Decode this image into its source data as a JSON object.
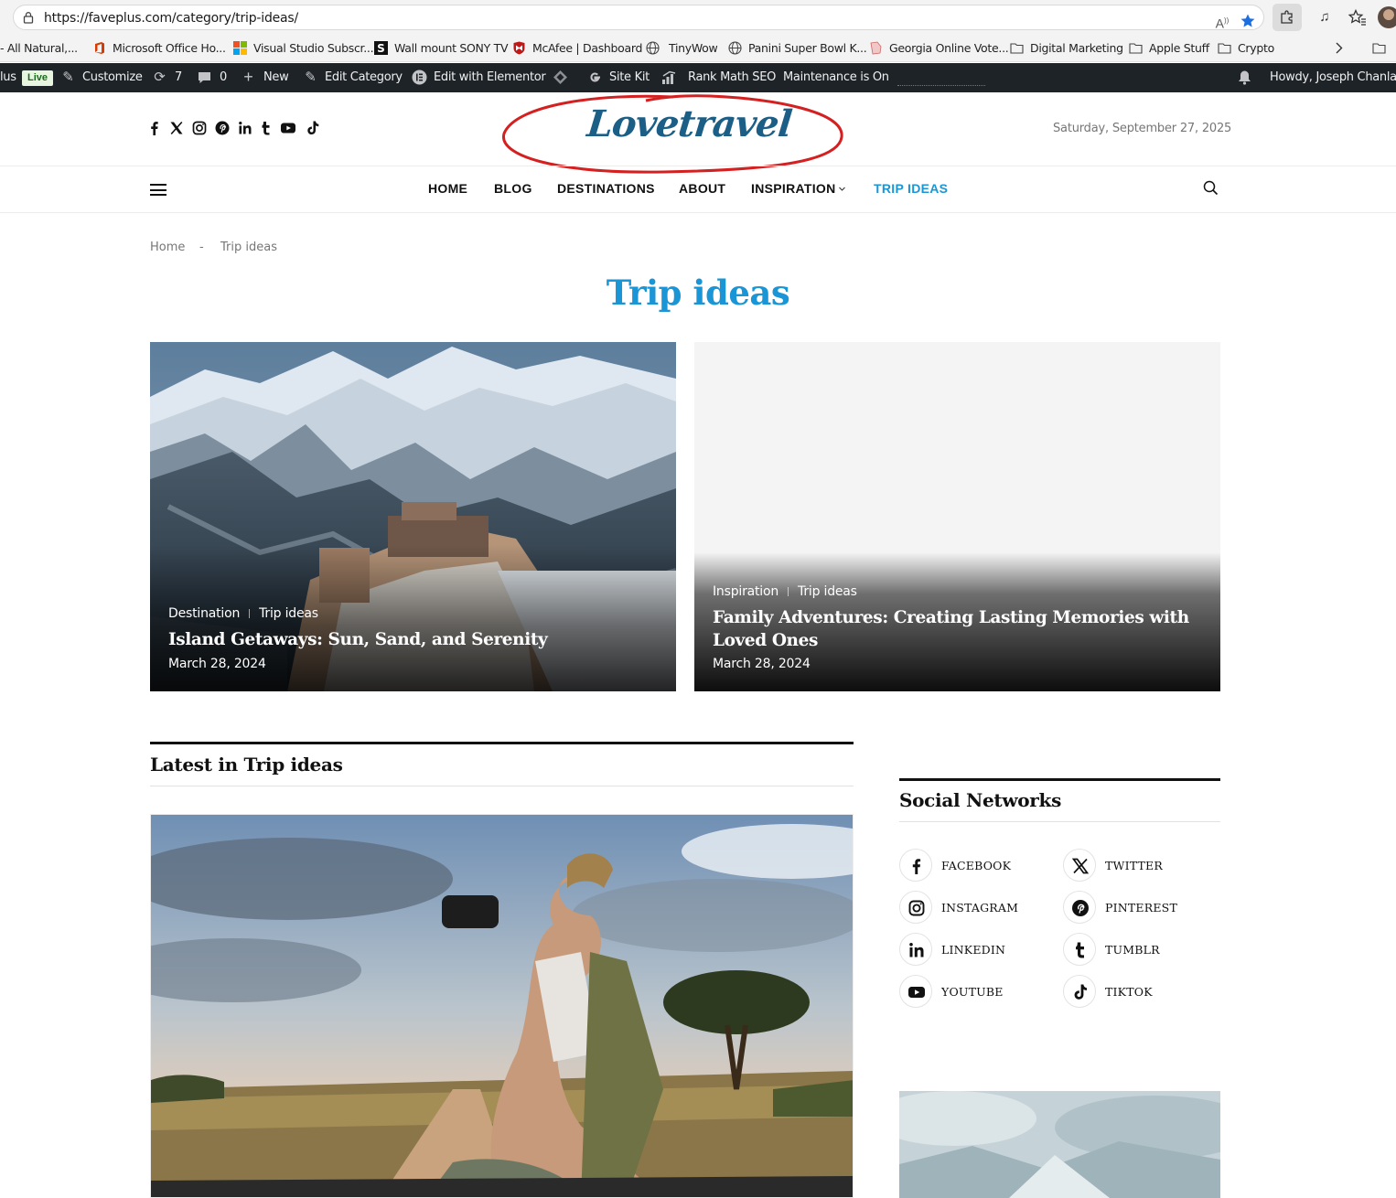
{
  "browser": {
    "url": "https://faveplus.com/category/trip-ideas/",
    "bookmarks": [
      "- All Natural,...",
      "Microsoft Office Ho...",
      "Visual Studio Subscr...",
      "Wall mount SONY TV",
      "McAfee | Dashboard",
      "TinyWow",
      "Panini Super Bowl K...",
      "Georgia Online Vote...",
      "Digital Marketing",
      "Apple Stuff",
      "Crypto"
    ]
  },
  "admin_bar": {
    "site_fragment": "lus",
    "live_badge": "Live",
    "customize": "Customize",
    "updates_count": "7",
    "comments_count": "0",
    "new": "New",
    "edit_category": "Edit Category",
    "elementor": "Edit with Elementor",
    "site_kit": "Site Kit",
    "rank_math": "Rank Math SEO",
    "maintenance": "Maintenance is On",
    "howdy": "Howdy, Joseph Chanlatte"
  },
  "header": {
    "logo": "Lovetravel",
    "date": "Saturday, September 27, 2025",
    "social_icons": [
      "facebook-icon",
      "x-icon",
      "instagram-icon",
      "pinterest-icon",
      "linkedin-icon",
      "tumblr-icon",
      "youtube-icon",
      "tiktok-icon"
    ]
  },
  "nav": {
    "items": [
      "HOME",
      "BLOG",
      "DESTINATIONS",
      "ABOUT",
      "INSPIRATION",
      "TRIP IDEAS"
    ],
    "active_color": "#1a96d6"
  },
  "breadcrumb": {
    "home": "Home",
    "separator": "-",
    "current": "Trip ideas"
  },
  "page_title": "Trip ideas",
  "featured": [
    {
      "cat1": "Destination",
      "cat2": "Trip ideas",
      "title": "Island Getaways: Sun, Sand, and Serenity",
      "date": "March 28, 2024"
    },
    {
      "cat1": "Inspiration",
      "cat2": "Trip ideas",
      "title": "Family Adventures: Creating Lasting Memories with Loved Ones",
      "date": "March 28, 2024"
    }
  ],
  "latest": {
    "title": "Latest in Trip ideas"
  },
  "sidebar": {
    "title": "Social Networks",
    "networks": [
      "FACEBOOK",
      "TWITTER",
      "INSTAGRAM",
      "PINTEREST",
      "LINKEDIN",
      "TUMBLR",
      "YOUTUBE",
      "TIKTOK"
    ]
  },
  "colors": {
    "accent": "#1a96d6",
    "admin_bar": "#1d2327",
    "logo": "#1c5f86",
    "annotation_circle": "#d42020"
  }
}
